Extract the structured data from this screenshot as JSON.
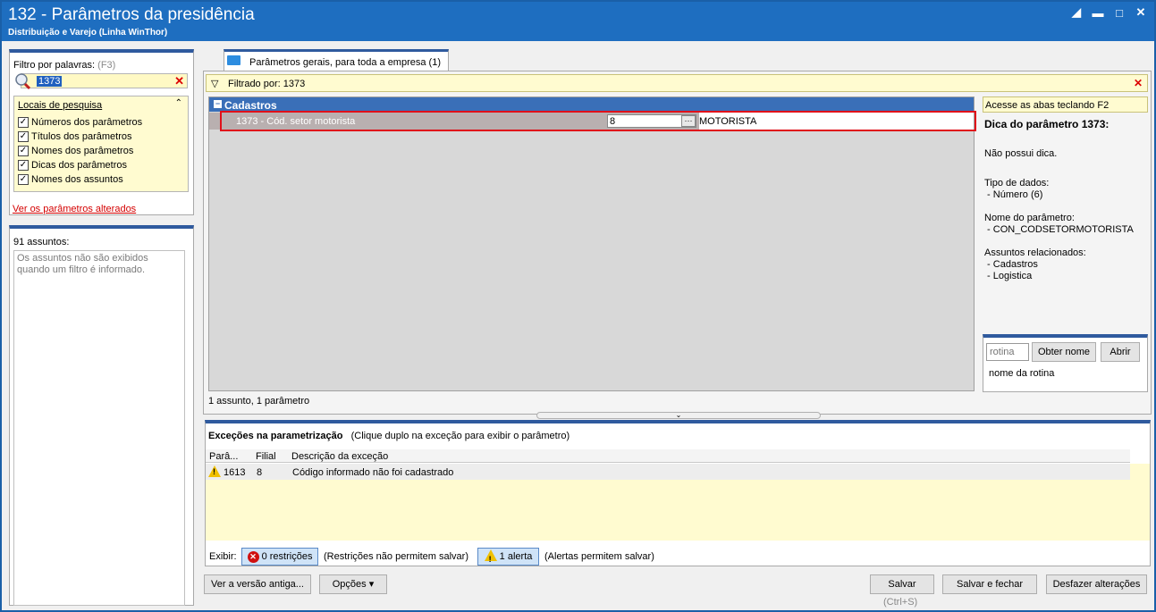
{
  "window": {
    "title": "132 - Parâmetros da presidência",
    "subtitle": "Distribuição e Varejo (Linha WinThor)",
    "controls": [
      "restore-icon",
      "minimize-icon",
      "maximize-icon",
      "close-icon"
    ]
  },
  "left": {
    "filter_label": "Filtro por palavras:",
    "filter_shortcut": "(F3)",
    "search_value": "1373",
    "locais_header": "Locais de pesquisa",
    "locais_items": [
      "Números dos parâmetros",
      "Títulos dos parâmetros",
      "Nomes dos parâmetros",
      "Dicas dos parâmetros",
      "Nomes dos assuntos"
    ],
    "changed_link": "Ver os parâmetros alterados",
    "assuntos_count": "91 assuntos:",
    "assuntos_msg": "Os assuntos não são exibidos quando um filtro é informado."
  },
  "tab": {
    "label": "Parâmetros gerais, para toda a empresa  (1)"
  },
  "filter_bar": {
    "text": "Filtrado por: 1373"
  },
  "grid": {
    "group": "Cadastros",
    "row": {
      "name": "1373 - Cód. setor motorista",
      "value": "8",
      "description": "MOTORISTA"
    },
    "count": "1 assunto, 1 parâmetro"
  },
  "hint": {
    "tabs_hint": "Acesse as abas teclando F2",
    "title": "Dica do parâmetro 1373:",
    "text": "Não possui dica.",
    "tipo_label": "Tipo de dados:",
    "tipo_value": " - Número (6)",
    "nome_label": "Nome do parâmetro:",
    "nome_value": " - CON_CODSETORMOTORISTA",
    "assuntos_label": "Assuntos relacionados:",
    "assuntos": [
      " - Cadastros",
      " - Logistica"
    ]
  },
  "rotina": {
    "placeholder": "rotina",
    "obter_btn": "Obter nome",
    "abrir_btn": "Abrir",
    "label": "nome da rotina"
  },
  "exceptions": {
    "title": "Exceções na parametrização",
    "subtitle": "(Clique duplo na exceção para exibir o parâmetro)",
    "columns": [
      "Parâ...",
      "Filial",
      "Descrição da exceção"
    ],
    "rows": [
      {
        "param": "1613",
        "filial": "8",
        "desc": "Código informado não foi cadastrado"
      }
    ],
    "exibir": "Exibir:",
    "restricoes_btn": "0 restrições",
    "restricoes_note": "(Restrições não permitem salvar)",
    "alerta_btn": "1 alerta",
    "alerta_note": "(Alertas permitem salvar)"
  },
  "bottom": {
    "old_version": "Ver a versão antiga...",
    "options": "Opções",
    "save": "Salvar",
    "save_shortcut": "(Ctrl+S)",
    "save_close": "Salvar e fechar",
    "undo": "Desfazer alterações"
  }
}
